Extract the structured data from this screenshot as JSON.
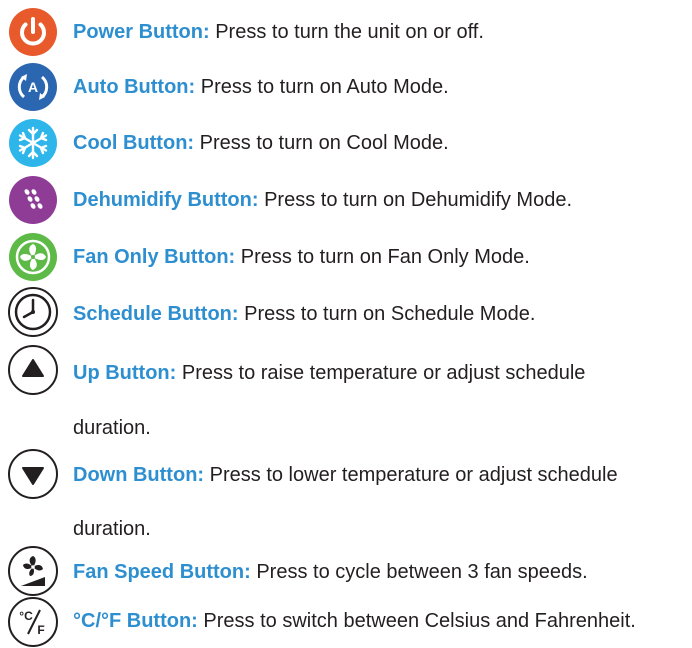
{
  "items": [
    {
      "icon": "power-icon",
      "label": "Power Button:",
      "desc": "Press to turn the unit on or off.",
      "color": "#e8592b"
    },
    {
      "icon": "auto-mode-icon",
      "label": "Auto Button:",
      "desc": "Press to turn on Auto Mode.",
      "color": "#2a67b0",
      "icon_text": "A"
    },
    {
      "icon": "snowflake-icon",
      "label": "Cool Button:",
      "desc": "Press to turn on Cool Mode.",
      "color": "#2eb6ea"
    },
    {
      "icon": "droplets-icon",
      "label": "Dehumidify Button:",
      "desc": "Press to turn on Dehumidify Mode.",
      "color": "#8f3c97"
    },
    {
      "icon": "fan-icon",
      "label": "Fan Only Button:",
      "desc": "Press to turn on Fan Only Mode.",
      "color": "#5dba47"
    },
    {
      "icon": "clock-icon",
      "label": "Schedule Button:",
      "desc": "Press to turn on Schedule Mode."
    },
    {
      "icon": "up-arrow-icon",
      "label": "Up Button:",
      "desc": "Press to raise temperature or adjust schedule",
      "cont": "duration."
    },
    {
      "icon": "down-arrow-icon",
      "label": "Down Button:",
      "desc": "Press to lower temperature or adjust schedule",
      "cont": "duration."
    },
    {
      "icon": "fan-speed-icon",
      "label": "Fan Speed Button:",
      "desc": "Press to cycle between 3 fan speeds."
    },
    {
      "icon": "celsius-fahrenheit-icon",
      "label": "°C/°F Button:",
      "desc": "Press to switch between Celsius and Fahrenheit.",
      "icon_text_c": "°C",
      "icon_text_f": "F"
    }
  ],
  "colors": {
    "label": "#2e8fd0",
    "text": "#231f20"
  }
}
